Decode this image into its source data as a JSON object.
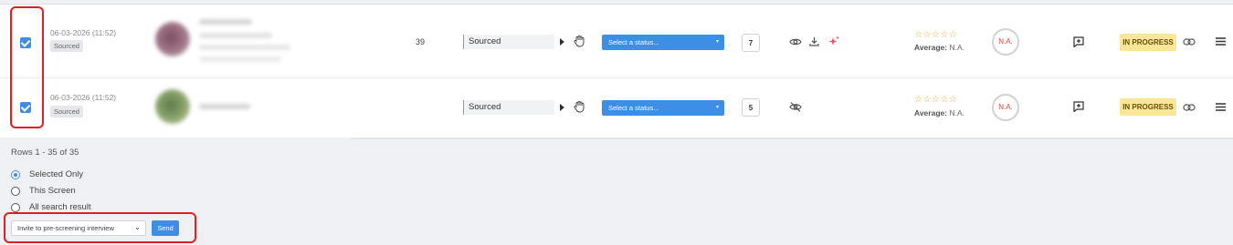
{
  "rows": [
    {
      "date": "06-03-2026 (11:52)",
      "badge": "Sourced",
      "count_value": "39",
      "stage": "Sourced",
      "status_placeholder": "Select a status...",
      "number_box": "7",
      "rating_stars": 0,
      "average_label": "Average:",
      "average_value": "N.A.",
      "score": "N.A.",
      "progress": "IN PROGRESS",
      "icons": [
        "eye-icon",
        "download-icon",
        "sparkle-icon"
      ]
    },
    {
      "date": "06-03-2026 (11:52)",
      "badge": "Sourced",
      "count_value": "",
      "stage": "Sourced",
      "status_placeholder": "Select a status...",
      "number_box": "5",
      "rating_stars": 0,
      "average_label": "Average:",
      "average_value": "N.A.",
      "score": "N.A.",
      "progress": "IN PROGRESS",
      "icons": [
        "eye-off-icon"
      ]
    }
  ],
  "footer": {
    "rows_info": "Rows 1 - 35 of 35",
    "options": [
      "Selected Only",
      "This Screen",
      "All search result"
    ],
    "selected_option": "Selected Only",
    "action_select": "Invite to pre-screening interview",
    "send_label": "Send"
  },
  "colors": {
    "accent": "#3d8fe6",
    "highlight": "#e02020",
    "progress_bg": "#f8e79a",
    "star": "#e4b03a",
    "score_text": "#d94545"
  }
}
